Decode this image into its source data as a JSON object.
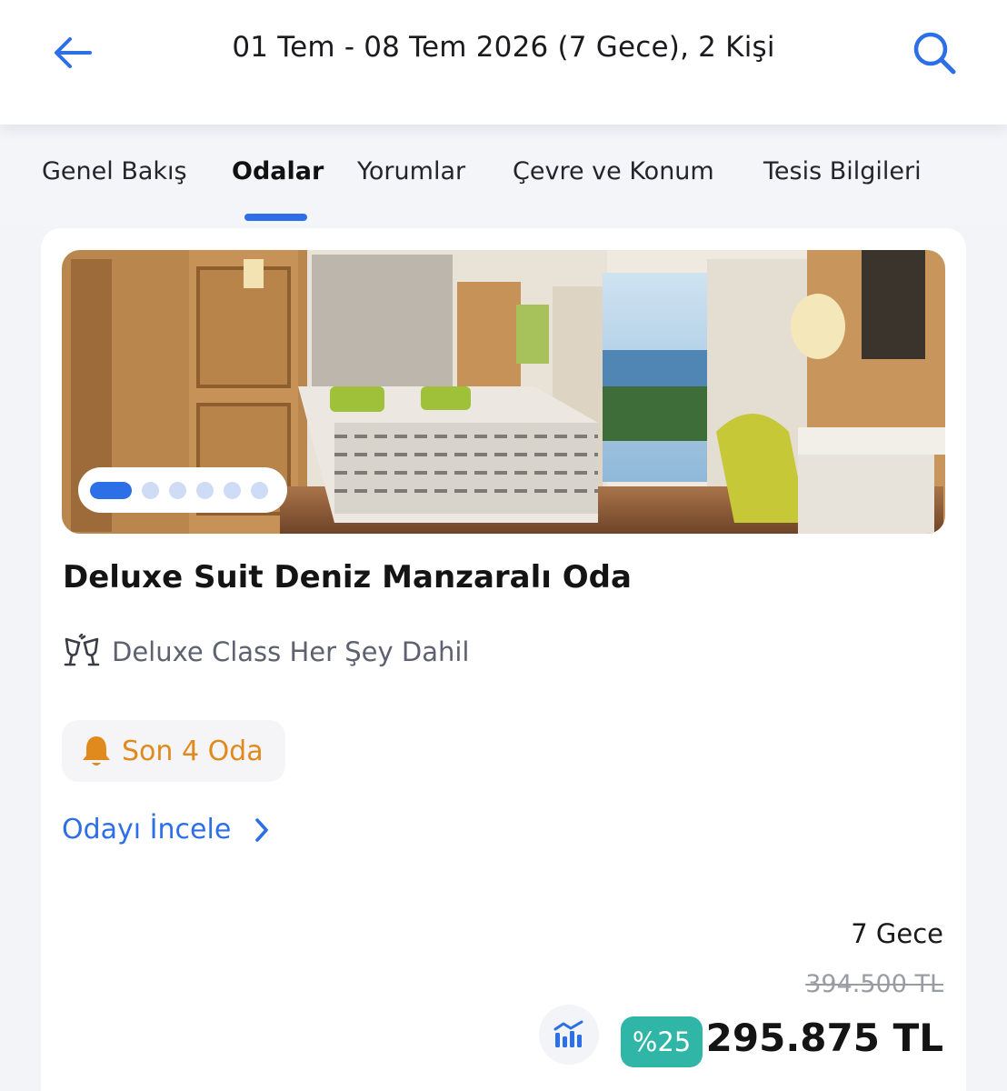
{
  "header": {
    "title": "01 Tem - 08 Tem 2026 (7 Gece), 2 Kişi",
    "back_icon": "arrow-left-icon",
    "search_icon": "search-icon",
    "accent_color": "#2d6fe6"
  },
  "tabs": [
    {
      "label": "Genel Bakış",
      "active": false
    },
    {
      "label": "Odalar",
      "active": true
    },
    {
      "label": "Yorumlar",
      "active": false
    },
    {
      "label": "Çevre ve Konum",
      "active": false
    },
    {
      "label": "Tesis Bilgileri",
      "active": false
    }
  ],
  "room": {
    "photo_count": 6,
    "active_photo_index": 0,
    "name": "Deluxe Suit Deniz Manzaralı Oda",
    "board": "Deluxe Class Her Şey Dahil",
    "board_icon": "cheers-glasses-icon",
    "availability": "Son 4 Oda",
    "availability_icon": "bell-icon",
    "availability_color": "#e08a1e",
    "inspect_link": "Odayı İncele",
    "inspect_icon": "chevron-right-icon"
  },
  "pricing": {
    "nights": "7 Gece",
    "old_price": "394.500 TL",
    "discount": "%25",
    "discount_color": "#2fb6a6",
    "price": "295.875 TL",
    "chart_icon": "price-chart-icon"
  }
}
